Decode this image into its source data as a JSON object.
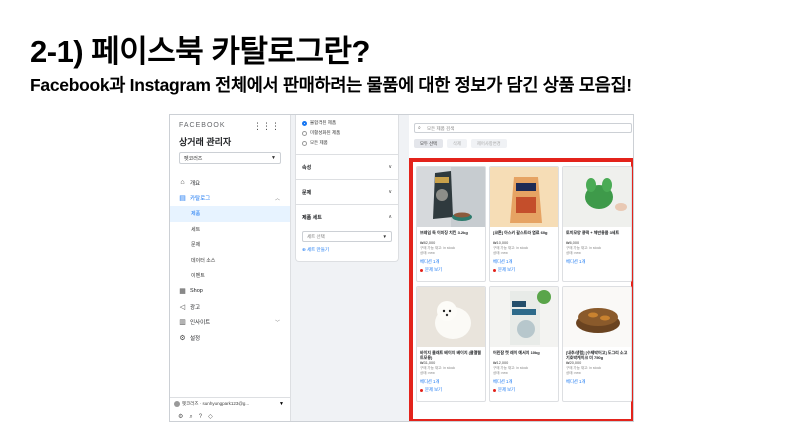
{
  "slide": {
    "title": "2-1) 페이스북 카탈로그란?",
    "subtitle": "Facebook과 Instagram 전체에서 판매하려는 물품에 대한 정보가 담긴 상품 모음집!"
  },
  "sidebar": {
    "brand": "FACEBOOK",
    "title": "상거래 관리자",
    "business_select": "펫코러즈",
    "nav": [
      {
        "label": "개요",
        "icon": "home-icon"
      },
      {
        "label": "카탈로그",
        "icon": "catalog-icon"
      },
      {
        "label": "제품"
      },
      {
        "label": "세트"
      },
      {
        "label": "문제"
      },
      {
        "label": "데이터 소스"
      },
      {
        "label": "이벤트"
      },
      {
        "label": "Shop",
        "icon": "shop-icon"
      },
      {
        "label": "광고",
        "icon": "megaphone-icon"
      },
      {
        "label": "인사이트",
        "icon": "chart-icon"
      },
      {
        "label": "설정",
        "icon": "gear-icon"
      }
    ],
    "account_label": "펫코러즈 · sunhyungpark123@g..."
  },
  "filters": {
    "options": [
      "불합격된 제품",
      "미활성화된 제품",
      "모든 제품"
    ],
    "sections": [
      "속성",
      "문제",
      "제품 세트"
    ],
    "set_placeholder": "세트 선택",
    "make_set": "세트 만들기"
  },
  "main": {
    "search_placeholder": "모든 제품 검색",
    "buttons": [
      "모두 선택",
      "삭제",
      "제어사항변경"
    ],
    "colors": {
      "highlight": "#e3231b",
      "link": "#1877f2"
    },
    "products": [
      {
        "name": "브레임 득 이미징 치킨 3.2kg",
        "price": "₩82,000",
        "stock": "구매 가능 재고: in stock",
        "status": "상태: new",
        "version": "베디션 1개",
        "issue": "문제 보기"
      },
      {
        "name": "[코튼] 아스키 갈스트라 염료 60g",
        "price": "₩10,000",
        "stock": "구매 가능 재고: in stock",
        "status": "상태: new",
        "version": "베디션 1개",
        "issue": "문제 보기"
      },
      {
        "name": "토끼모양 콩떡 + 체반용품 3세트",
        "price": "₩6,000",
        "stock": "구매 가능 재고: in stock",
        "status": "상태: new",
        "version": "베디션 1개",
        "issue": ""
      },
      {
        "name": "바이지 클래트 베이지 베이지 (클앨캘트모용)",
        "price": "₩31,000",
        "stock": "구매 가능 재고: in stock",
        "status": "상태: new",
        "version": "베디션 1개",
        "issue": "문제 보기"
      },
      {
        "name": "어린잠 캣 레이 예서지 10kg",
        "price": "₩12,000",
        "stock": "구매 가능 재고: in stock",
        "status": "상태: new",
        "version": "베디션 1개",
        "issue": "문제 보기"
      },
      {
        "name": "[내추/생럼] [수제박어고] 도그리 소고기호박케이크 미 750g",
        "price": "₩20,000",
        "stock": "구매 가능 재고: in stock",
        "status": "상태: new",
        "version": "베디션 1개",
        "issue": ""
      }
    ]
  }
}
